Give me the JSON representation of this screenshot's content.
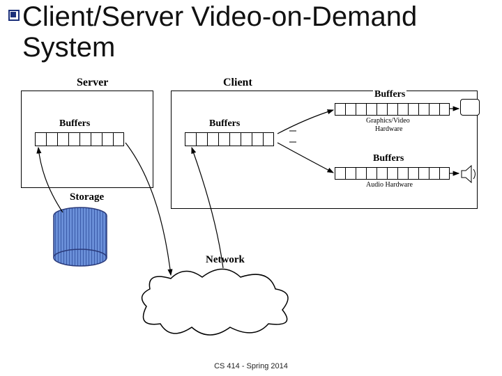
{
  "title": "Client/Server Video-on-Demand System",
  "labels": {
    "server": "Server",
    "client": "Client",
    "storage": "Storage",
    "network": "Network",
    "buffers1": "Buffers",
    "buffers2": "Buffers",
    "buffers3": "Buffers",
    "buffers4": "Buffers",
    "gvhw": "Graphics/Video",
    "gvhw2": "Hardware",
    "audiohw": "Audio Hardware"
  },
  "footer": "CS 414 - Spring 2014"
}
